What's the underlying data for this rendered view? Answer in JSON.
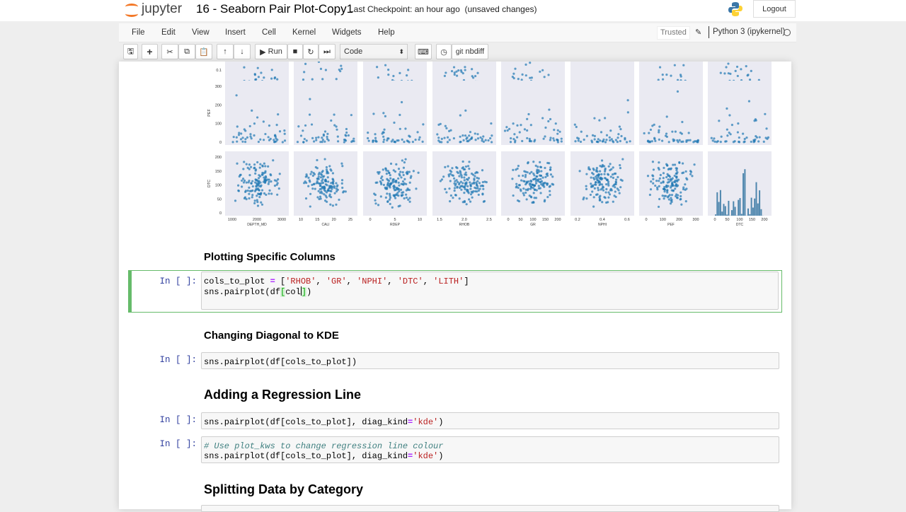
{
  "header": {
    "logo_text": "jupyter",
    "notebook_title": "16 - Seaborn Pair Plot-Copy1",
    "checkpoint": "Last Checkpoint: an hour ago",
    "unsaved": "(unsaved changes)",
    "logout": "Logout"
  },
  "menubar": {
    "items": [
      "File",
      "Edit",
      "View",
      "Insert",
      "Cell",
      "Kernel",
      "Widgets",
      "Help"
    ],
    "trusted": "Trusted",
    "kernel": "Python 3 (ipykernel)"
  },
  "toolbar": {
    "run": "Run",
    "cell_type": "Code",
    "nbdiff": "nbdiff",
    "git": "git"
  },
  "output_figure": {
    "columns": [
      {
        "label": "DEPTH_MD",
        "ticks": [
          "1000",
          "2000",
          "3000"
        ]
      },
      {
        "label": "CALI",
        "ticks": [
          "10",
          "15",
          "20",
          "25"
        ]
      },
      {
        "label": "RDEP",
        "ticks": [
          "0",
          "5",
          "10"
        ]
      },
      {
        "label": "RHOB",
        "ticks": [
          "1.5",
          "2.0",
          "2.5"
        ]
      },
      {
        "label": "GR",
        "ticks": [
          "0",
          "50",
          "100",
          "150",
          "200"
        ]
      },
      {
        "label": "NPHI",
        "ticks": [
          "0.2",
          "0.4",
          "0.6"
        ]
      },
      {
        "label": "PEF",
        "ticks": [
          "0",
          "100",
          "200",
          "300"
        ]
      },
      {
        "label": "DTC",
        "ticks": [
          "0",
          "50",
          "100",
          "150",
          "200"
        ]
      }
    ],
    "rows": [
      {
        "label": "",
        "ticks": [
          "0.1"
        ]
      },
      {
        "label": "PEF",
        "ticks": [
          "0",
          "100",
          "200",
          "300"
        ]
      },
      {
        "label": "DTC",
        "ticks": [
          "0",
          "50",
          "100",
          "150",
          "200"
        ]
      }
    ],
    "colors": {
      "point": "#1f77b4",
      "panel_bg": "#eaeaf2"
    }
  },
  "cells": [
    {
      "type": "heading",
      "text": "Plotting Specific Columns"
    },
    {
      "type": "code",
      "prompt": "In [ ]:",
      "line1": {
        "a": "cols_to_plot ",
        "op": "=",
        "b": " [",
        "s1": "'RHOB'",
        "c1": ", ",
        "s2": "'GR'",
        "c2": ", ",
        "s3": "'NPHI'",
        "c3": ", ",
        "s4": "'DTC'",
        "c4": ", ",
        "s5": "'LITH'",
        "end": "]"
      },
      "line2": {
        "a": "sns.pairplot(df",
        "br": "[",
        "b": "col",
        "br2": "]",
        "end": ")"
      }
    },
    {
      "type": "heading",
      "text": "Changing Diagonal to KDE"
    },
    {
      "type": "code",
      "prompt": "In [ ]:",
      "code": "sns.pairplot(df[cols_to_plot])"
    },
    {
      "type": "heading",
      "text": "Adding a Regression Line"
    },
    {
      "type": "code",
      "prompt": "In [ ]:",
      "a": "sns.pairplot(df[cols_to_plot], diag_kind",
      "op": "=",
      "s": "'kde'",
      "end": ")"
    },
    {
      "type": "code",
      "prompt": "In [ ]:",
      "comment": "# Use plot_kws to change regression line colour",
      "a": "sns.pairplot(df[cols_to_plot], diag_kind",
      "op": "=",
      "s": "'kde'",
      "end": ")"
    },
    {
      "type": "heading",
      "text": "Splitting Data by Category"
    }
  ]
}
